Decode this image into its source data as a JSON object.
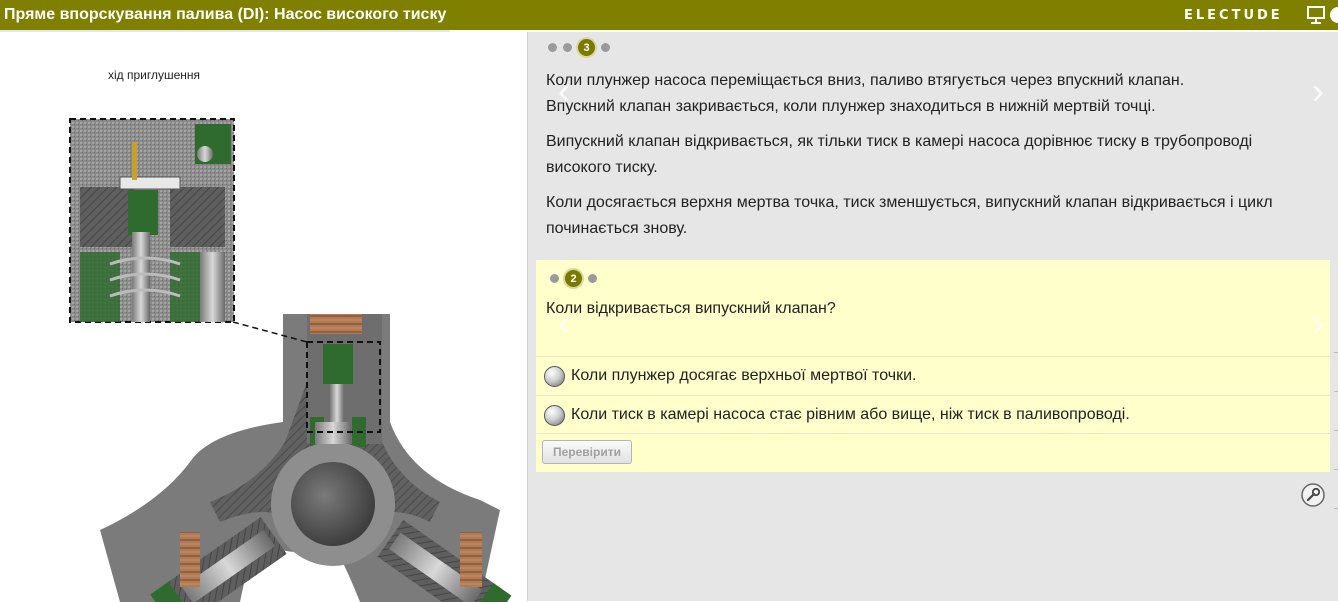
{
  "header": {
    "title": "Пряме впорскування палива (DI): Насос високого тиску",
    "brand": "ELECTUDE",
    "icons": [
      "presentation-icon",
      "half-circle-icon"
    ],
    "color": "#7f7f00"
  },
  "illustration": {
    "caption": "хід приглушення"
  },
  "info": {
    "steps": [
      "",
      "",
      "3",
      ""
    ],
    "paragraphs": [
      "Коли плунжер насоса переміщається вниз, паливо втягується через впускний клапан. Впускний клапан закривається, коли плунжер знаходиться в нижній мертвій точці.",
      "Випускний клапан відкривається, як тільки тиск в камері насоса дорівнює тиску в трубопроводі високого тиску.",
      "Коли досягається верхня мертва точка, тиск зменшується, випускний клапан відкривається і цикл починається знову."
    ]
  },
  "quiz": {
    "steps": [
      "",
      "2",
      ""
    ],
    "question": "Коли відкривається випускний клапан?",
    "answers": [
      "Коли плунжер досягає верхньої мертвої точки.",
      "Коли тиск в камері насоса стає рівним або вище, ніж тиск в паливопроводі."
    ],
    "check_label": "Перевірити",
    "background": "#ffffcc"
  },
  "tools": {
    "icon": "wrench-icon"
  }
}
